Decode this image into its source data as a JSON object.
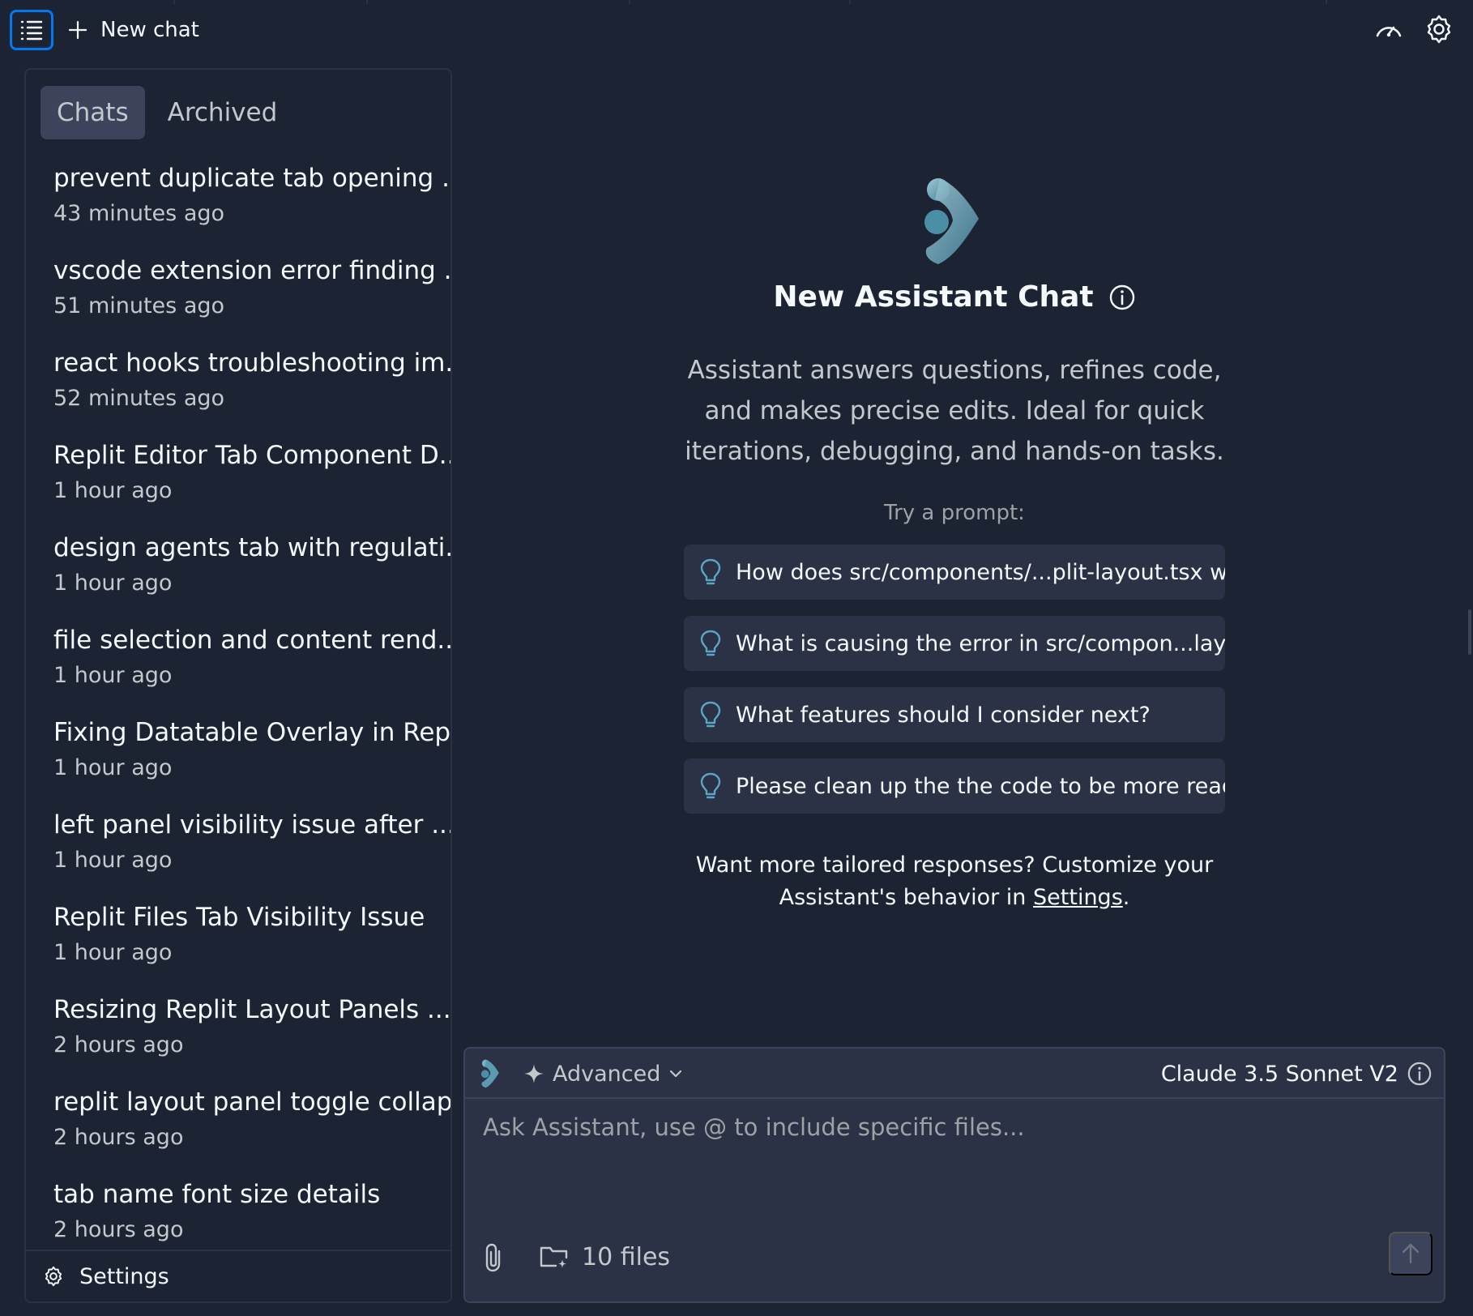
{
  "header": {
    "new_chat_label": "New chat"
  },
  "sidebar": {
    "tabs": [
      {
        "label": "Chats",
        "active": true
      },
      {
        "label": "Archived",
        "active": false
      }
    ],
    "chats": [
      {
        "title": "prevent duplicate tab opening ...",
        "time": "43 minutes ago"
      },
      {
        "title": "vscode extension error finding ...",
        "time": "51 minutes ago"
      },
      {
        "title": "react hooks troubleshooting im...",
        "time": "52 minutes ago"
      },
      {
        "title": "Replit Editor Tab Component D...",
        "time": "1 hour ago"
      },
      {
        "title": "design agents tab with regulati...",
        "time": "1 hour ago"
      },
      {
        "title": "file selection and content rend...",
        "time": "1 hour ago"
      },
      {
        "title": "Fixing Datatable Overlay in Rep...",
        "time": "1 hour ago"
      },
      {
        "title": "left panel visibility issue after ...",
        "time": "1 hour ago"
      },
      {
        "title": "Replit Files Tab Visibility Issue",
        "time": "1 hour ago"
      },
      {
        "title": "Resizing Replit Layout Panels ...",
        "time": "2 hours ago"
      },
      {
        "title": "replit layout panel toggle collap...",
        "time": "2 hours ago"
      },
      {
        "title": "tab name font size details",
        "time": "2 hours ago"
      }
    ],
    "footer_settings_label": "Settings"
  },
  "main": {
    "title": "New Assistant Chat",
    "description": "Assistant answers questions, refines code, and makes precise edits. Ideal for quick iterations, debugging, and hands-on tasks.",
    "try_label": "Try a prompt:",
    "prompts": [
      "How does src/components/...plit-layout.tsx work?",
      "What is causing the error in src/compon...layout.tsx",
      "What features should I consider next?",
      "Please clean up the the code to be more readable."
    ],
    "customize_text": "Want more tailored responses? Customize your Assistant's behavior in",
    "customize_link": "Settings",
    "customize_suffix": "."
  },
  "composer": {
    "mode_label": "Advanced",
    "model_label": "Claude 3.5 Sonnet V2",
    "placeholder": "Ask Assistant, use @ to include specific files...",
    "files_label": "10 files"
  },
  "colors": {
    "background": "#1c2333",
    "surface": "#2b3245",
    "accent": "#0079f2",
    "logo": "#5a9bb0"
  },
  "icons": [
    "list-icon",
    "plus-icon",
    "speedometer-icon",
    "gear-icon",
    "logo-icon",
    "info-icon",
    "lightbulb-icon",
    "sparkle-icon",
    "chevron-down-icon",
    "paperclip-icon",
    "folder-plus-icon",
    "arrow-up-icon"
  ]
}
